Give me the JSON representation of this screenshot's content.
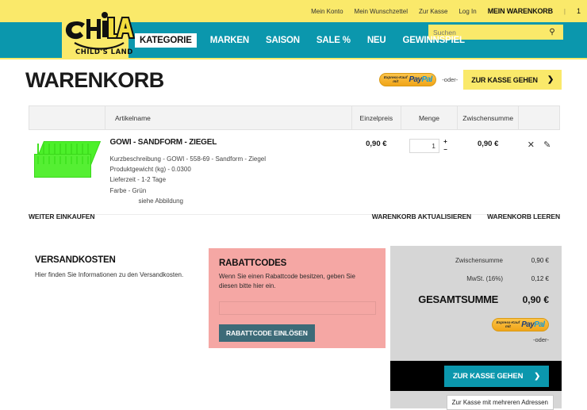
{
  "header": {
    "logo": {
      "brand": "CHiLA",
      "tagline": "CHILD'S LAND"
    },
    "utility": [
      {
        "label": "Mein Konto",
        "name": "mein-konto"
      },
      {
        "label": "Mein Wunschzettel",
        "name": "mein-wunschzettel"
      },
      {
        "label": "Zur Kasse",
        "name": "zur-kasse"
      },
      {
        "label": "Log In",
        "name": "log-in"
      }
    ],
    "cart_label": "MEIN WARENKORB",
    "cart_separator": "|",
    "cart_count": "1",
    "nav": [
      {
        "label": "KATEGORIE",
        "active": true
      },
      {
        "label": "MARKEN",
        "active": false
      },
      {
        "label": "SAISON",
        "active": false
      },
      {
        "label": "SALE %",
        "active": false
      },
      {
        "label": "NEU",
        "active": false
      },
      {
        "label": "GEWINNSPIEL",
        "active": false
      }
    ],
    "search": {
      "placeholder": "Suchen",
      "value": "",
      "icon": "search-icon"
    },
    "colors": {
      "yellow": "#fae96a",
      "teal": "#0b97ad"
    }
  },
  "page": {
    "title": "WARENKORB"
  },
  "top_checkout": {
    "paypal_express_line1": "Express-Kauf",
    "paypal_express_line2": "mit",
    "paypal_pay": "Pay",
    "paypal_pal": "Pal",
    "oder": "-oder-",
    "checkout_label": "ZUR KASSE GEHEN",
    "chevron": "❯"
  },
  "table": {
    "headers": {
      "image": "",
      "name": "Artikelname",
      "price": "Einzelpreis",
      "qty": "Menge",
      "subtotal": "Zwischensumme",
      "actions": ""
    },
    "rows": [
      {
        "name": "GOWI - SANDFORM - ZIEGEL",
        "attributes": [
          "Kurzbeschreibung - GOWI - 558-69 - Sandform - Ziegel",
          "Produktgewicht (kg) - 0.0300",
          "Lieferzeit - 1-2 Tage",
          "Farbe - Grün"
        ],
        "attribute_indent": "siehe Abbildung",
        "price": "0,90 €",
        "qty": "1",
        "qty_plus": "+",
        "qty_minus": "−",
        "subtotal": "0,90 €",
        "remove_icon": "✕",
        "edit_icon": "✎"
      }
    ]
  },
  "actions": {
    "continue_shopping": "WEITER EINKAUFEN",
    "update_cart": "WARENKORB AKTUALISIEREN",
    "empty_cart": "WARENKORB LEEREN"
  },
  "shipping": {
    "title": "VERSANDKOSTEN",
    "text": "Hier finden Sie Informationen zu den Versandkosten."
  },
  "coupon": {
    "title": "RABATTCODES",
    "text": "Wenn Sie einen Rabattcode besitzen, geben Sie diesen bitte hier ein.",
    "input_value": "",
    "input_placeholder": "",
    "button": "RABATTCODE EINLÖSEN",
    "bg_color": "#f5a7a4",
    "button_color": "#3d6b78"
  },
  "summary": {
    "rows": [
      {
        "label": "Zwischensumme",
        "value": "0,90 €"
      },
      {
        "label": "MwSt. (16%)",
        "value": "0,12 €"
      }
    ],
    "total_label": "GESAMTSUMME",
    "total_value": "0,90 €",
    "paypal_express_line1": "Express-Kauf",
    "paypal_express_line2": "mit",
    "paypal_pay": "Pay",
    "paypal_pal": "Pal",
    "oder": "-oder-",
    "checkout_label": "ZUR KASSE GEHEN",
    "chevron": "❯",
    "multi_address": "Zur Kasse mit mehreren Adressen"
  }
}
